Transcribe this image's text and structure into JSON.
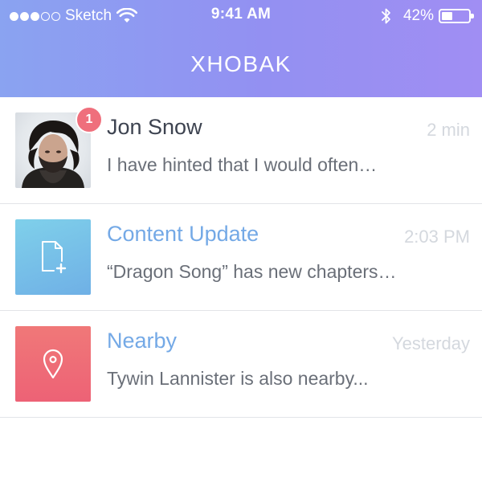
{
  "status_bar": {
    "carrier": "Sketch",
    "time": "9:41 AM",
    "battery_percent_text": "42%",
    "battery_level": 0.42,
    "signal_dots_filled": 3,
    "signal_dots_total": 5
  },
  "header": {
    "title": "XHOBAK",
    "gradient_colors": [
      "#8aa3f1",
      "#a08ef3"
    ]
  },
  "notifications": [
    {
      "title": "Jon Snow",
      "message": "I have hinted that I would often…",
      "time": "2 min",
      "badge": "1",
      "thumb": "avatar-photo"
    },
    {
      "title": "Content Update",
      "message": "“Dragon Song” has new chapters…",
      "time": "2:03 PM",
      "thumb": "document-add-icon",
      "accent": "#74a9e6"
    },
    {
      "title": "Nearby",
      "message": "Tywin Lannister is also nearby...",
      "time": "Yesterday",
      "thumb": "location-pin-icon",
      "accent": "#74a9e6"
    }
  ],
  "colors": {
    "badge": "#ef6f7c",
    "tile_blue": "#6fb0e6",
    "tile_red": "#ed6276"
  }
}
